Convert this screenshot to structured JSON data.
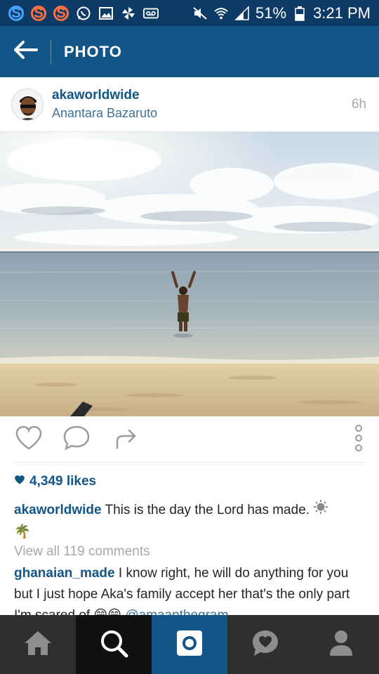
{
  "status_bar": {
    "battery": "51%",
    "time": "3:21 PM"
  },
  "app_bar": {
    "title": "PHOTO"
  },
  "post": {
    "username": "akaworldwide",
    "location": "Anantara Bazaruto",
    "time_ago": "6h",
    "likes": "4,349 likes",
    "caption_user": "akaworldwide",
    "caption_text": "This is the day the Lord has made.",
    "caption_emoji_2": "🌴",
    "view_all_comments": "View all 119 comments",
    "comment_user": "ghanaian_made",
    "comment_text": "I know right, he will do anything for you but I just hope Aka's family accept her that's the only part I'm scared of",
    "comment_emoji": "😁😁",
    "comment_mention": "@amaanthegram"
  },
  "colors": {
    "status_bar_bg": "#0d3b66",
    "app_bar_bg": "#125688",
    "username": "#125688",
    "location": "#3f729b",
    "muted": "#a5a7aa",
    "nav_bg": "#2f2f2f",
    "nav_active": "#125688"
  },
  "bottom_nav": [
    "home-icon",
    "search-icon",
    "camera-icon",
    "activity-icon",
    "profile-icon"
  ]
}
